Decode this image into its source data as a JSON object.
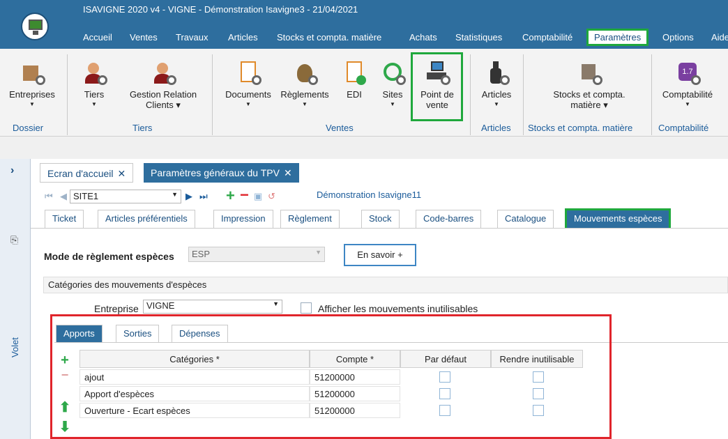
{
  "window": {
    "title": "ISAVIGNE 2020 v4 - VIGNE - Démonstration Isavigne3 - 21/04/2021"
  },
  "menu": [
    "Accueil",
    "Ventes",
    "Travaux",
    "Articles",
    "Stocks et compta. matière",
    "Achats",
    "Statistiques",
    "Comptabilité",
    "Paramètres",
    "Options",
    "Aide"
  ],
  "ribbon": {
    "buttons": [
      "Entreprises",
      "Tiers",
      "Gestion Relation",
      "Clients",
      "Documents",
      "Règlements",
      "EDI",
      "Sites",
      "Point de",
      "vente",
      "Articles",
      "Stocks et compta.",
      "matière",
      "Comptabilité"
    ],
    "groups": [
      "Dossier",
      "Tiers",
      "Ventes",
      "Articles",
      "Stocks et compta. matière",
      "Comptabilité"
    ]
  },
  "leftpanel": {
    "volet": "Volet"
  },
  "doctabs": [
    "Ecran d'accueil",
    "Paramètres généraux du TPV"
  ],
  "nav": {
    "site": "SITE1",
    "demo": "Démonstration Isavigne11"
  },
  "paramtabs": [
    "Ticket",
    "Articles préférentiels",
    "Impression",
    "Règlement",
    "Stock",
    "Code-barres",
    "Catalogue",
    "Mouvements espèces"
  ],
  "mode": {
    "label": "Mode de règlement espèces",
    "value": "ESP",
    "button": "En savoir +"
  },
  "categories": {
    "title": "Catégories des mouvements d'espèces",
    "entreprise_label": "Entreprise",
    "entreprise_value": "VIGNE",
    "checkbox_label": "Afficher les mouvements inutilisables"
  },
  "innertabs": [
    "Apports",
    "Sorties",
    "Dépenses"
  ],
  "grid": {
    "headers": [
      "Catégories *",
      "Compte *",
      "Par défaut",
      "Rendre inutilisable"
    ],
    "rows": [
      {
        "cat": "ajout",
        "compte": "51200000"
      },
      {
        "cat": "Apport d'espèces",
        "compte": "51200000"
      },
      {
        "cat": "Ouverture - Ecart espèces",
        "compte": "51200000"
      }
    ]
  },
  "colors": {
    "titlebar": "#2e6e9e",
    "highlight_green": "#1fa83c",
    "highlight_red": "#e0242b"
  }
}
